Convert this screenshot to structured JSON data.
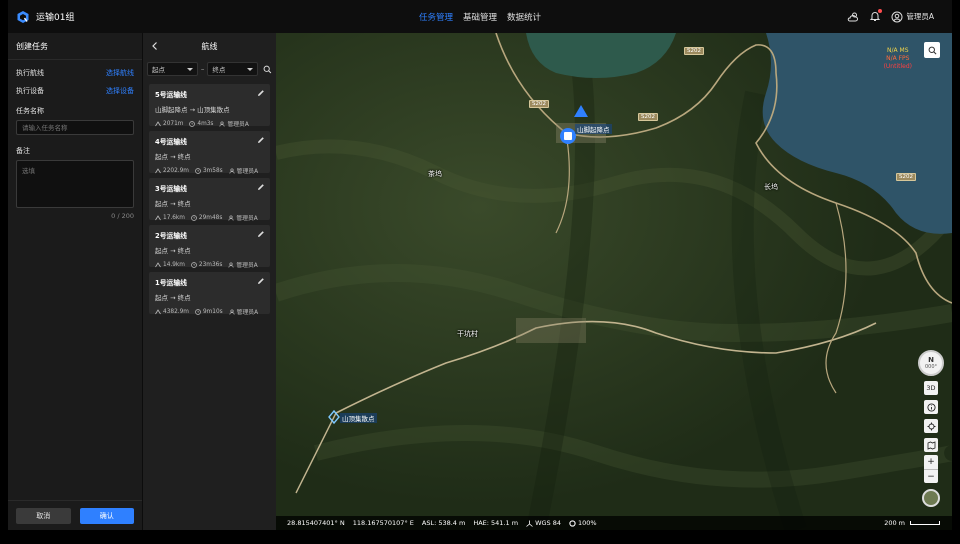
{
  "header": {
    "app_title": "运输01组",
    "nav": [
      "任务管理",
      "基础管理",
      "数据统计"
    ],
    "user_name": "管理员A"
  },
  "create_task": {
    "title": "创建任务",
    "route_label": "执行航线",
    "route_link": "选择航线",
    "device_label": "执行设备",
    "device_link": "选择设备",
    "name_label": "任务名称",
    "name_placeholder": "请输入任务名称",
    "note_label": "备注",
    "note_placeholder": "选填",
    "counter": "0 / 200",
    "cancel_label": "取消",
    "confirm_label": "确认"
  },
  "routes": {
    "title": "航线",
    "start_placeholder": "起点",
    "end_placeholder": "终点",
    "separator": "–",
    "items": [
      {
        "name": "5号运输线",
        "path": "山脚起降点 → 山顶集散点",
        "distance": "2071m",
        "duration": "4m3s",
        "owner": "管理员A"
      },
      {
        "name": "4号运输线",
        "path": "起点 → 终点",
        "distance": "2202.9m",
        "duration": "3m58s",
        "owner": "管理员A"
      },
      {
        "name": "3号运输线",
        "path": "起点 → 终点",
        "distance": "17.6km",
        "duration": "29m48s",
        "owner": "管理员A"
      },
      {
        "name": "2号运输线",
        "path": "起点 → 终点",
        "distance": "14.9km",
        "duration": "23m36s",
        "owner": "管理员A"
      },
      {
        "name": "1号运输线",
        "path": "起点 → 终点",
        "distance": "4382.9m",
        "duration": "9m10s",
        "owner": "管理员A"
      }
    ]
  },
  "map": {
    "places": {
      "chawu": "茶坞",
      "changwu": "长坞",
      "ganhang": "干坑村"
    },
    "roads": [
      "S202",
      "S202",
      "S202",
      "S202"
    ],
    "markers": {
      "top": "山脚起降点",
      "bottom": "山顶集散点"
    },
    "fps": {
      "ms": "N/A MS",
      "fps": "N/A FPS",
      "untitled": "(Untitled)"
    },
    "compass": {
      "n": "N",
      "deg": "000°"
    },
    "view_3d": "3D",
    "status": {
      "lat": "28.815407401° N",
      "lon": "118.167570107° E",
      "asl": "ASL: 538.4 m",
      "hae": "HAE: 541.1 m",
      "datum": "WGS 84",
      "progress": "100%"
    },
    "scale_label": "200 m"
  }
}
